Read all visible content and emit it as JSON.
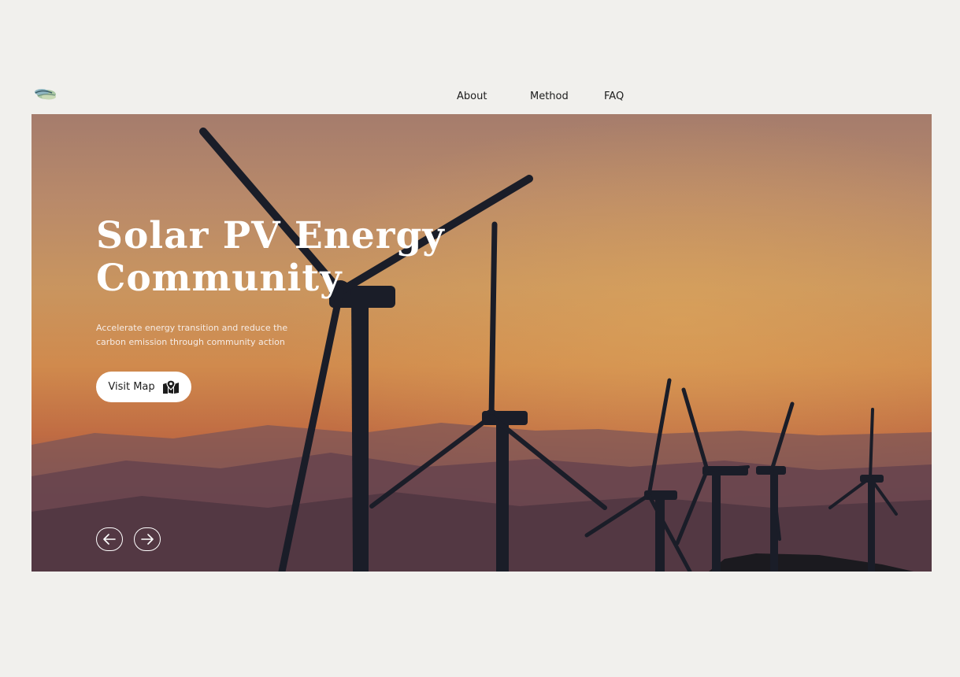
{
  "header": {
    "logo_icon": "wind-cloud-logo-icon",
    "nav": [
      {
        "label": "About"
      },
      {
        "label": "Method"
      },
      {
        "label": "FAQ"
      }
    ]
  },
  "hero": {
    "background_image": "wind-turbines-at-sunset",
    "title": "Solar PV Energy Community",
    "subtitle": "Accelerate energy transition and reduce the carbon emission through community action",
    "cta": {
      "label": "Visit Map",
      "icon": "map-location-icon"
    },
    "prev_icon": "arrow-left-icon",
    "next_icon": "arrow-right-icon"
  },
  "colors": {
    "page_background": "#f1f0ed",
    "text_dark": "#1c1c1c",
    "white": "#ffffff"
  }
}
